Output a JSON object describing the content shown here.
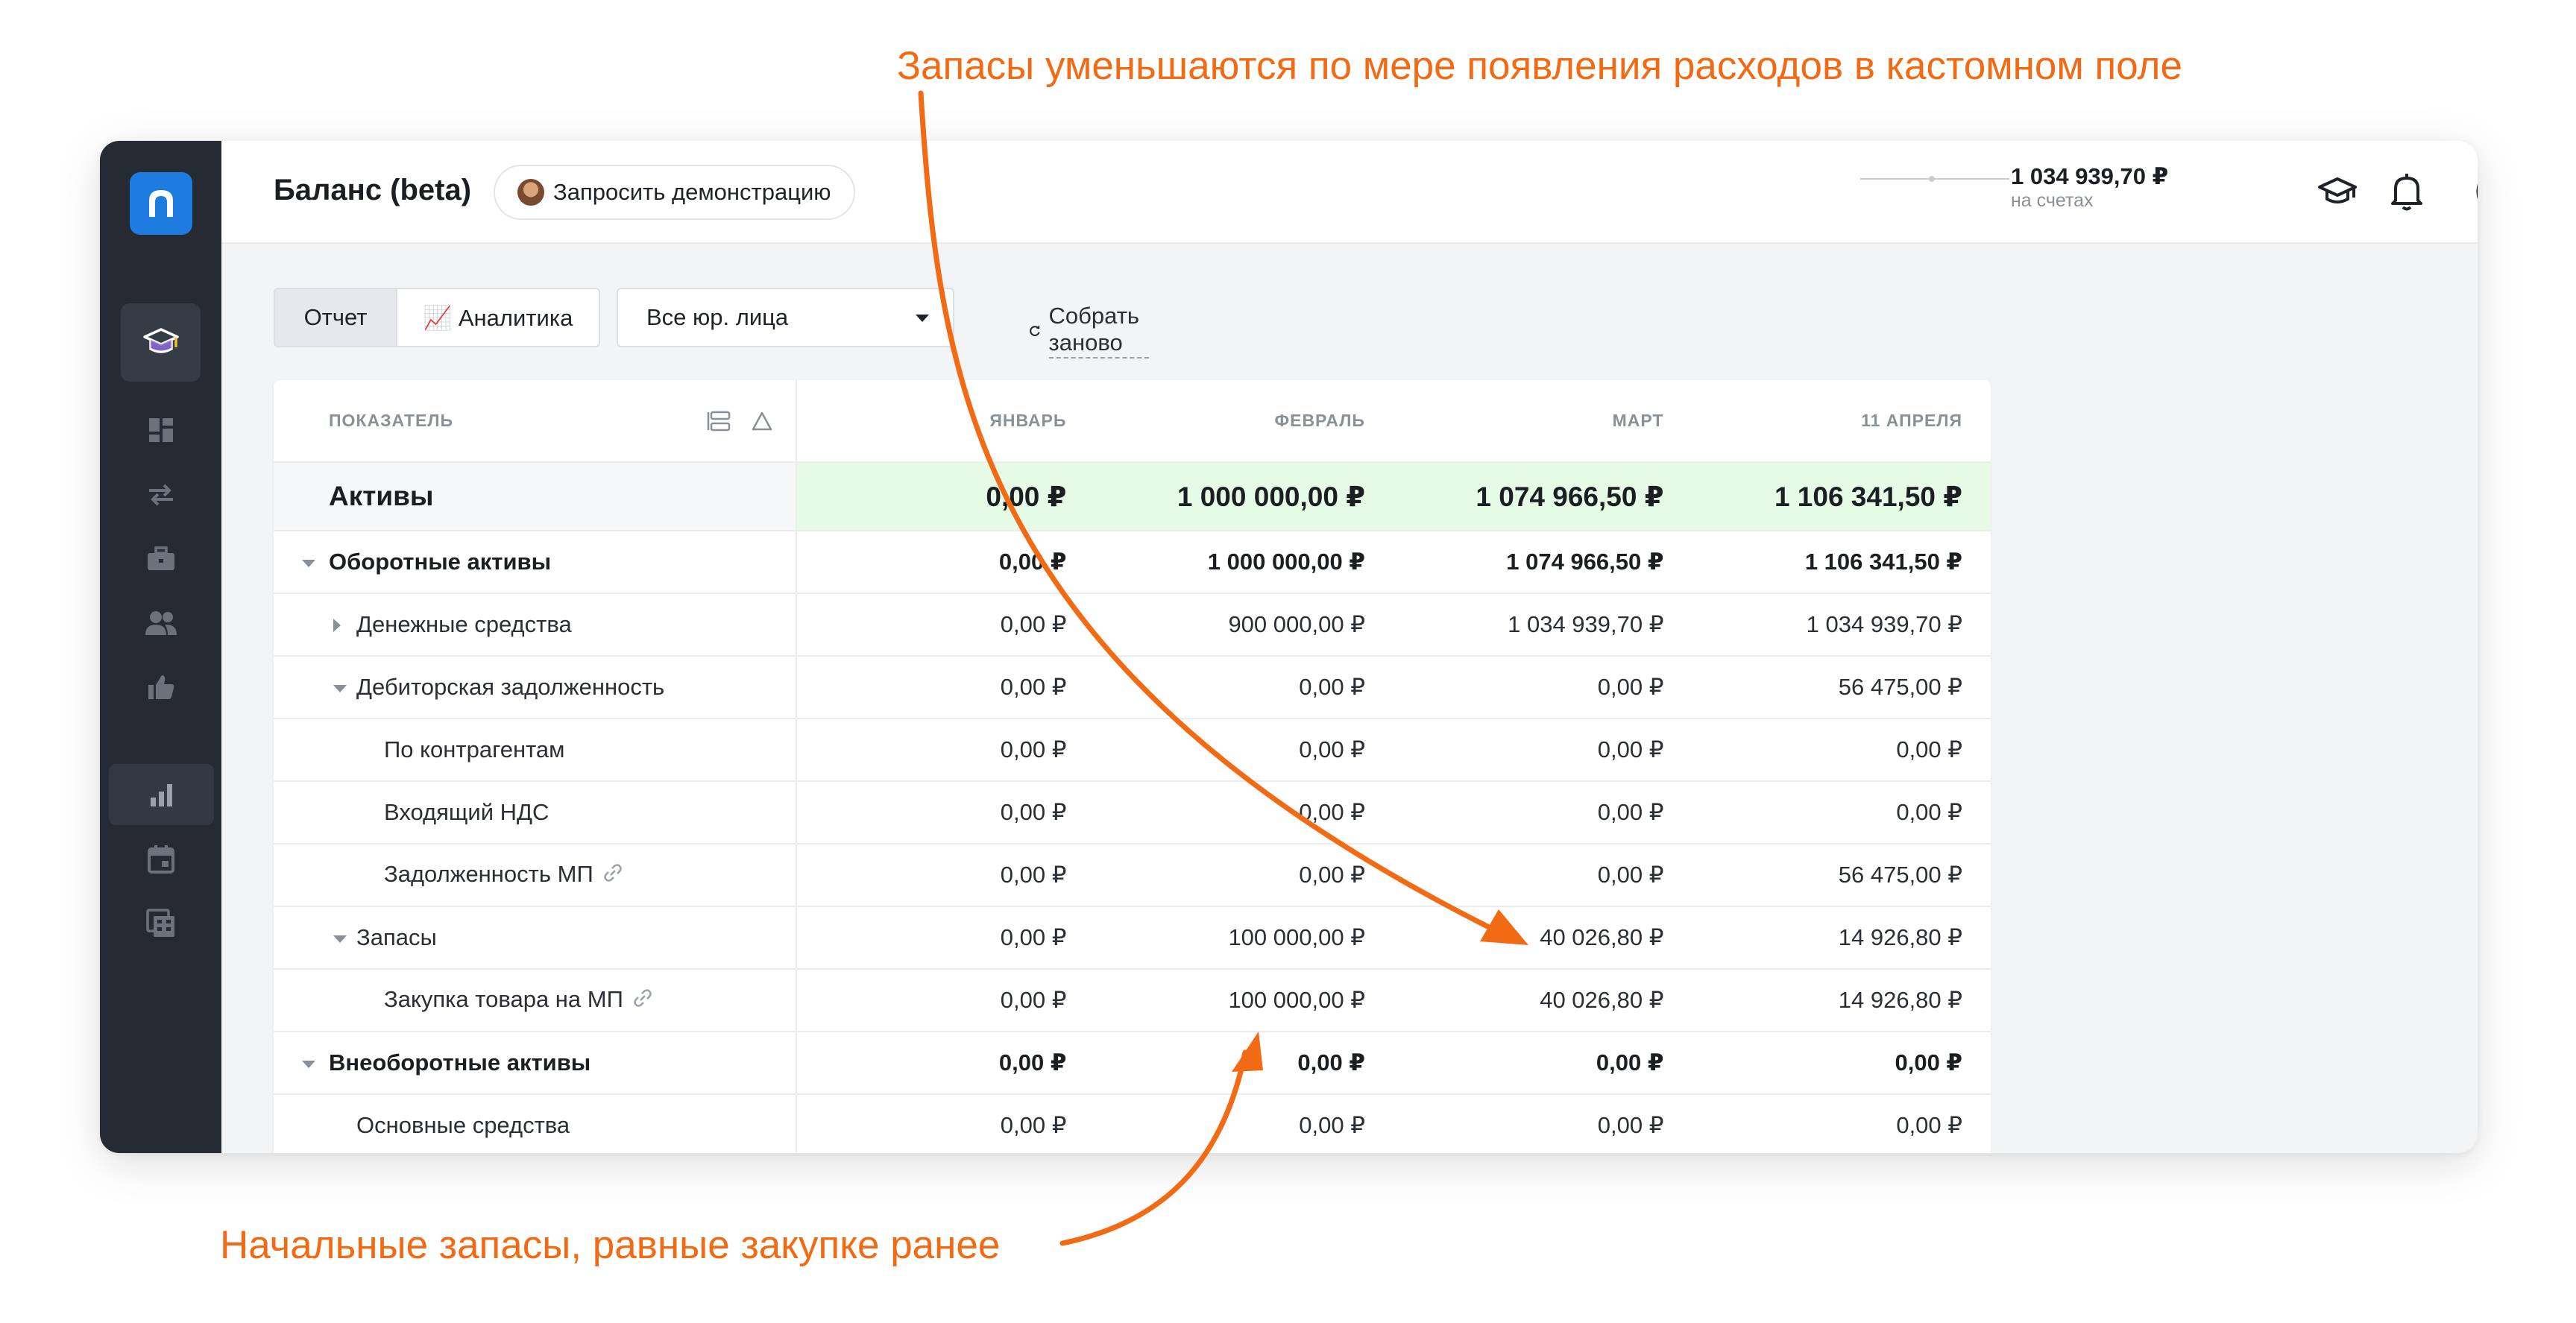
{
  "annotations": {
    "top": "Запасы уменьшаются по мере появления расходов в кастомном поле",
    "bottom": "Начальные запасы, равные закупке ранее",
    "color": "#f26a13"
  },
  "sidebar": {
    "background": "#262b33",
    "items": [
      {
        "name": "academy-icon"
      },
      {
        "name": "dashboard-icon"
      },
      {
        "name": "transfers-icon"
      },
      {
        "name": "briefcase-icon"
      },
      {
        "name": "contacts-icon"
      },
      {
        "name": "thumbs-up-icon"
      },
      {
        "name": "reports-chart-icon"
      },
      {
        "name": "calendar-icon"
      },
      {
        "name": "calculator-icon"
      }
    ]
  },
  "header": {
    "title": "Баланс (beta)",
    "demo_button": "Запросить демонстрацию",
    "balance": "1 034 939,70 ₽",
    "balance_caption": "на счетах"
  },
  "toolbar": {
    "tab_report": "Отчет",
    "tab_analytics": "📈 Аналитика",
    "entity_select": "Все юр. лица",
    "rebuild": "Собрать заново"
  },
  "table": {
    "columns": [
      "Показатель",
      "Январь",
      "Февраль",
      "Март",
      "11 апреля"
    ],
    "rows": [
      {
        "label": "Активы",
        "values": [
          "0,00 ₽",
          "1 000 000,00 ₽",
          "1 074 966,50 ₽",
          "1 106 341,50 ₽"
        ]
      },
      {
        "label": "Оборотные активы",
        "values": [
          "0,00 ₽",
          "1 000 000,00 ₽",
          "1 074 966,50 ₽",
          "1 106 341,50 ₽"
        ]
      },
      {
        "label": "Денежные средства",
        "values": [
          "0,00 ₽",
          "900 000,00 ₽",
          "1 034 939,70 ₽",
          "1 034 939,70 ₽"
        ]
      },
      {
        "label": "Дебиторская задолженность",
        "values": [
          "0,00 ₽",
          "0,00 ₽",
          "0,00 ₽",
          "56 475,00 ₽"
        ]
      },
      {
        "label": "По контрагентам",
        "values": [
          "0,00 ₽",
          "0,00 ₽",
          "0,00 ₽",
          "0,00 ₽"
        ]
      },
      {
        "label": "Входящий НДС",
        "values": [
          "0,00 ₽",
          "0,00 ₽",
          "0,00 ₽",
          "0,00 ₽"
        ]
      },
      {
        "label": "Задолженность МП",
        "values": [
          "0,00 ₽",
          "0,00 ₽",
          "0,00 ₽",
          "56 475,00 ₽"
        ]
      },
      {
        "label": "Запасы",
        "values": [
          "0,00 ₽",
          "100 000,00 ₽",
          "40 026,80 ₽",
          "14 926,80 ₽"
        ]
      },
      {
        "label": "Закупка товара на МП",
        "values": [
          "0,00 ₽",
          "100 000,00 ₽",
          "40 026,80 ₽",
          "14 926,80 ₽"
        ]
      },
      {
        "label": "Внеоборотные активы",
        "values": [
          "0,00 ₽",
          "0,00 ₽",
          "0,00 ₽",
          "0,00 ₽"
        ]
      },
      {
        "label": "Основные средства",
        "values": [
          "0,00 ₽",
          "0,00 ₽",
          "0,00 ₽",
          "0,00 ₽"
        ]
      }
    ],
    "highlight_color": "#e5fbe6"
  }
}
